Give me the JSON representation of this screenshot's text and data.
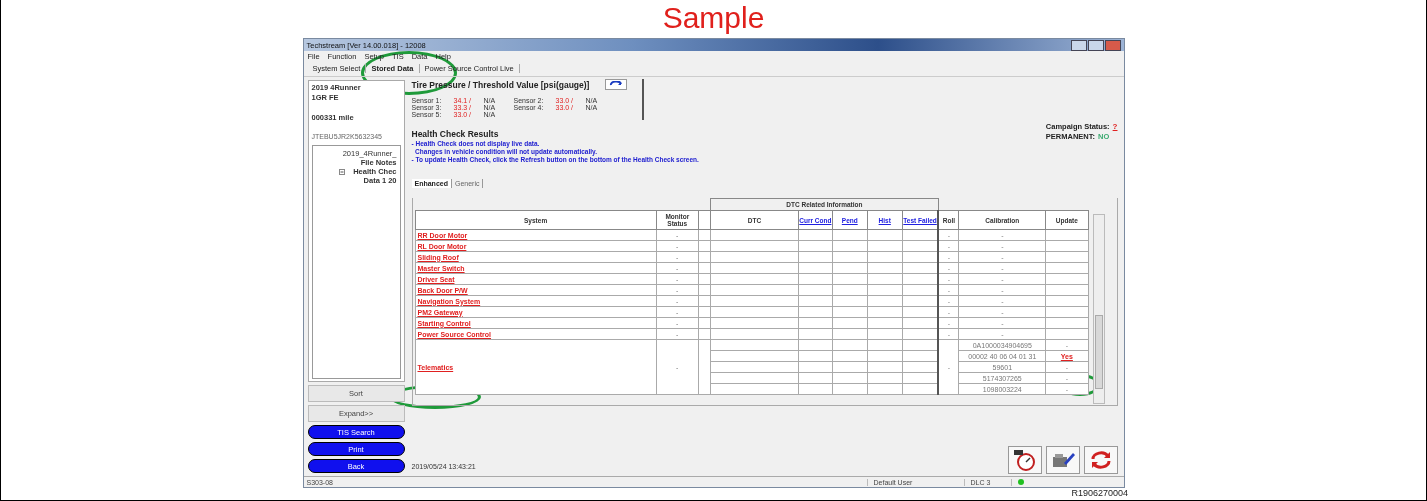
{
  "page_title": "Sample",
  "window": {
    "title": "Techstream [Ver 14.00.018] - 12008",
    "menu": [
      "File",
      "Function",
      "Setup",
      "TIS",
      "Data",
      "Help"
    ],
    "tabs": [
      {
        "label": "System Select",
        "selected": false
      },
      {
        "label": "Stored Data",
        "selected": true
      },
      {
        "label": "Power Source Control Live",
        "selected": false
      }
    ]
  },
  "sidebar": {
    "vehicle": [
      "2019 4Runner",
      "1GR FE"
    ],
    "mileage": "000331 mile",
    "vin": "JTEBU5JR2K5632345",
    "tree": [
      {
        "label": "2019_4Runner_",
        "children": [
          {
            "label": "File Notes"
          },
          {
            "label": "Health Chec",
            "children": [
              {
                "label": "Data 1 20"
              }
            ]
          }
        ]
      }
    ],
    "buttons": [
      {
        "label": "Sort",
        "kind": "gray"
      },
      {
        "label": "Expand>>",
        "kind": "gray"
      },
      {
        "label": "TIS Search",
        "kind": "blue"
      },
      {
        "label": "Print",
        "kind": "blue"
      },
      {
        "label": "Back",
        "kind": "blue"
      }
    ]
  },
  "tire_pressure": {
    "title": "Tire Pressure / Threshold Value [psi(gauge)]",
    "sensors": [
      {
        "label": "Sensor 1:",
        "value": "34.1 /",
        "threshold": "N/A"
      },
      {
        "label": "Sensor 2:",
        "value": "33.0 /",
        "threshold": "N/A"
      },
      {
        "label": "Sensor 3:",
        "value": "33.3 /",
        "threshold": "N/A"
      },
      {
        "label": "Sensor 4:",
        "value": "33.0 /",
        "threshold": "N/A"
      },
      {
        "label": "Sensor 5:",
        "value": "33.0 /",
        "threshold": "N/A"
      }
    ]
  },
  "health_check": {
    "title": "Health Check Results",
    "notes": [
      "- Health Check does not display live data.",
      "  Changes in vehicle condition will not update automatically.",
      "- To update Health Check, click the Refresh button on the bottom of the Health Check screen."
    ],
    "campaign_label": "Campaign Status:",
    "campaign_value": "?",
    "permanent_label": "PERMANENT:",
    "permanent_value": "NO"
  },
  "result_tabs": [
    {
      "label": "Enhanced",
      "selected": true
    },
    {
      "label": "Generic",
      "selected": false
    }
  ],
  "table": {
    "group_heading": "DTC Related Information",
    "columns": [
      {
        "label": "System",
        "kind": "plain"
      },
      {
        "label": "Monitor Status",
        "kind": "plain"
      },
      {
        "label": "DTC",
        "kind": "plain"
      },
      {
        "label": "Curr Cond",
        "kind": "link"
      },
      {
        "label": "Pend",
        "kind": "link"
      },
      {
        "label": "Hist",
        "kind": "link"
      },
      {
        "label": "Test Failed",
        "kind": "link"
      },
      {
        "label": "Roll",
        "kind": "plain"
      },
      {
        "label": "Calibration",
        "kind": "plain"
      },
      {
        "label": "Update",
        "kind": "plain"
      }
    ],
    "rows": [
      {
        "kind": "single",
        "system": "RR Door Motor",
        "monitor_status": "-",
        "roll": "-",
        "calibration": "-"
      },
      {
        "kind": "single",
        "system": "RL Door Motor",
        "monitor_status": "-",
        "roll": "-",
        "calibration": "-"
      },
      {
        "kind": "single",
        "system": "Sliding Roof",
        "monitor_status": "-",
        "roll": "-",
        "calibration": "-"
      },
      {
        "kind": "single",
        "system": "Master Switch",
        "monitor_status": "-",
        "roll": "-",
        "calibration": "-"
      },
      {
        "kind": "single",
        "system": "Driver Seat",
        "monitor_status": "-",
        "roll": "-",
        "calibration": "-"
      },
      {
        "kind": "single",
        "system": "Back Door P/W",
        "monitor_status": "-",
        "roll": "-",
        "calibration": "-"
      },
      {
        "kind": "single",
        "system": "Navigation System",
        "monitor_status": "-",
        "roll": "-",
        "calibration": "-"
      },
      {
        "kind": "single",
        "system": "PM2 Gateway",
        "monitor_status": "-",
        "roll": "-",
        "calibration": "-"
      },
      {
        "kind": "single",
        "system": "Starting Control",
        "monitor_status": "-",
        "roll": "-",
        "calibration": "-"
      },
      {
        "kind": "single",
        "system": "Power Source Control",
        "monitor_status": "-",
        "roll": "-",
        "calibration": "-"
      },
      {
        "kind": "multi",
        "system": "Telematics",
        "monitor_status": "-",
        "roll": "-",
        "parts": [
          {
            "calibration": "0A1000034904695",
            "update": "-",
            "kind": "plain"
          },
          {
            "calibration": "00002 40 06 04 01 31",
            "update": "Yes",
            "kind": "link"
          },
          {
            "calibration": "59601",
            "update": "-",
            "kind": "plain"
          },
          {
            "calibration": "5174307265",
            "update": "-",
            "kind": "plain"
          },
          {
            "calibration": "1098003224",
            "update": "-",
            "kind": "plain"
          }
        ]
      }
    ]
  },
  "timestamp": "2019/05/24 13:43:21",
  "status_bar": {
    "left": "S303-08",
    "user": "Default User",
    "connection": "DLC 3"
  },
  "reference": "R1906270004"
}
